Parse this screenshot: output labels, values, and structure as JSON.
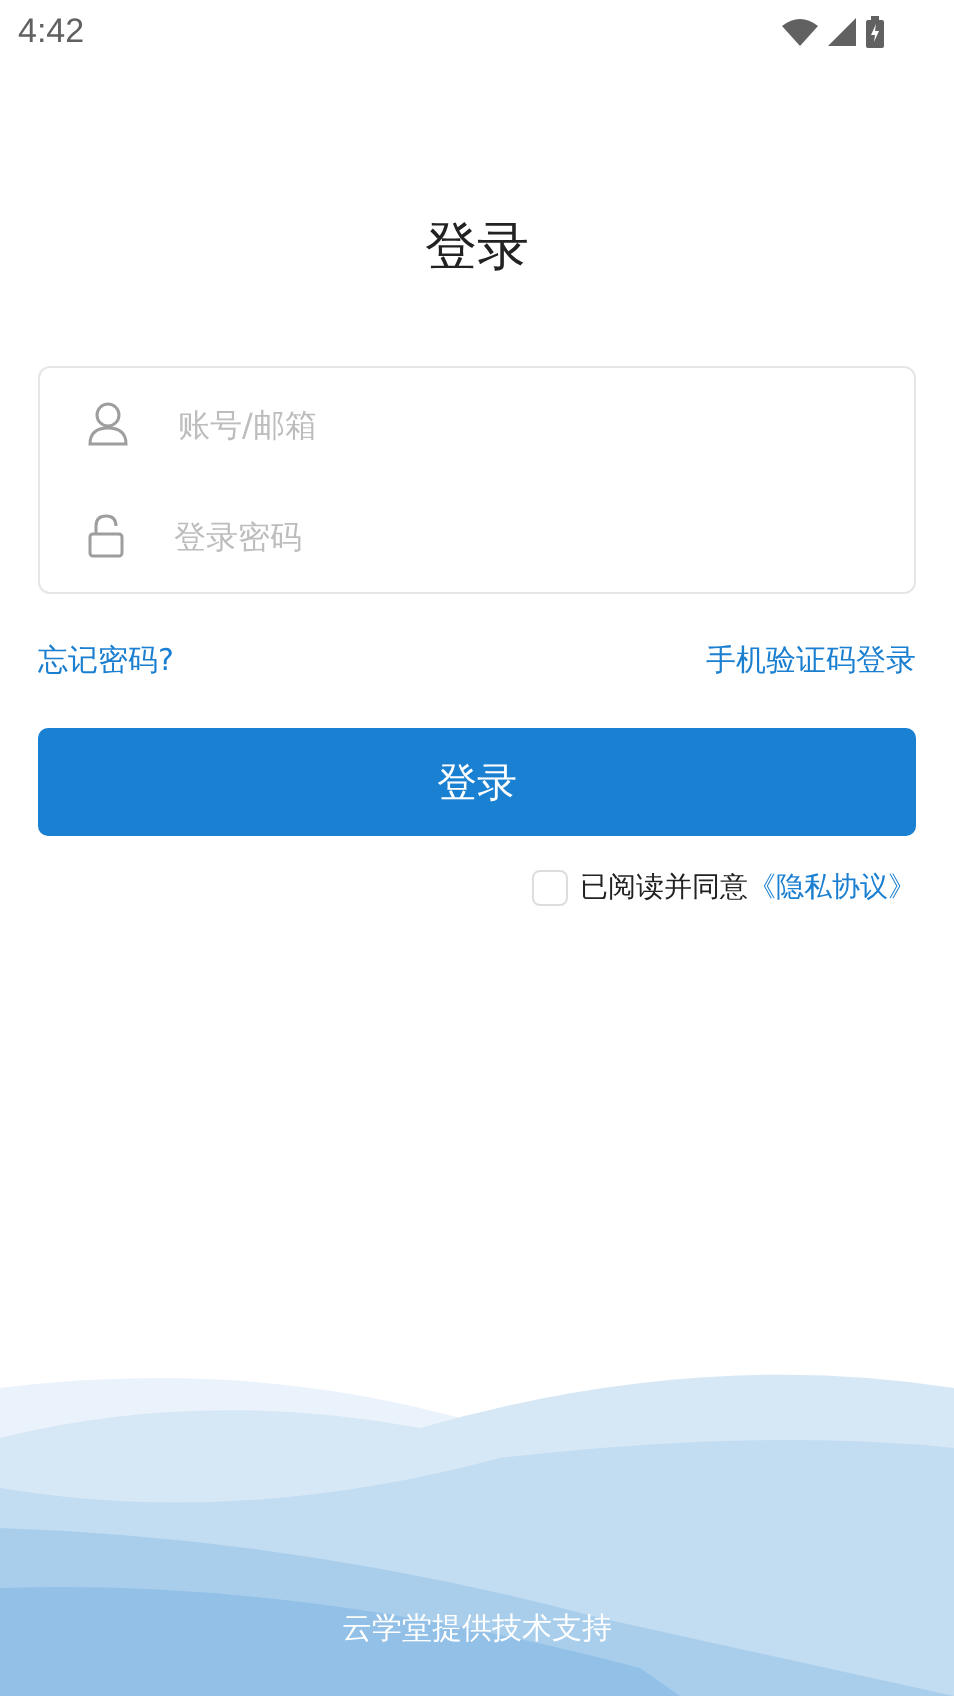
{
  "status_bar": {
    "time": "4:42"
  },
  "title": "登录",
  "form": {
    "fields": [
      {
        "kind": "account",
        "placeholder": "账号/邮箱"
      },
      {
        "kind": "password",
        "placeholder": "登录密码"
      }
    ]
  },
  "links": {
    "forgot": "忘记密码?",
    "sms_login": "手机验证码登录"
  },
  "login_button": "登录",
  "agreement": {
    "checked": false,
    "text": "已阅读并同意",
    "link": "《隐私协议》"
  },
  "footer": "云学堂提供技术支持"
}
